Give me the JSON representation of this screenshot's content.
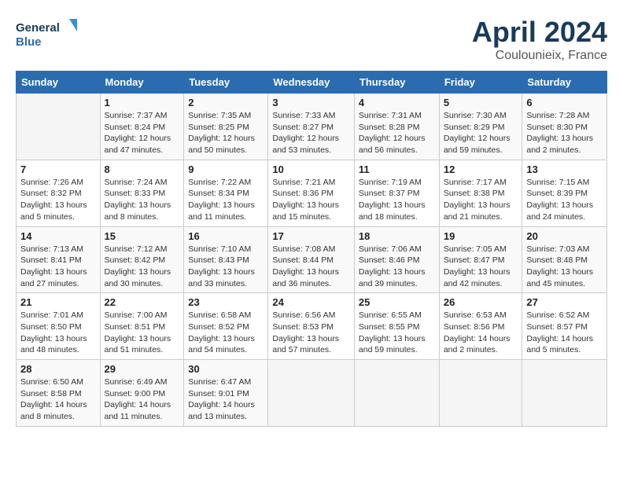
{
  "header": {
    "logo_line1": "General",
    "logo_line2": "Blue",
    "title": "April 2024",
    "subtitle": "Coulounieix, France"
  },
  "columns": [
    "Sunday",
    "Monday",
    "Tuesday",
    "Wednesday",
    "Thursday",
    "Friday",
    "Saturday"
  ],
  "weeks": [
    [
      {
        "day": "",
        "sunrise": "",
        "sunset": "",
        "daylight": ""
      },
      {
        "day": "1",
        "sunrise": "Sunrise: 7:37 AM",
        "sunset": "Sunset: 8:24 PM",
        "daylight": "Daylight: 12 hours and 47 minutes."
      },
      {
        "day": "2",
        "sunrise": "Sunrise: 7:35 AM",
        "sunset": "Sunset: 8:25 PM",
        "daylight": "Daylight: 12 hours and 50 minutes."
      },
      {
        "day": "3",
        "sunrise": "Sunrise: 7:33 AM",
        "sunset": "Sunset: 8:27 PM",
        "daylight": "Daylight: 12 hours and 53 minutes."
      },
      {
        "day": "4",
        "sunrise": "Sunrise: 7:31 AM",
        "sunset": "Sunset: 8:28 PM",
        "daylight": "Daylight: 12 hours and 56 minutes."
      },
      {
        "day": "5",
        "sunrise": "Sunrise: 7:30 AM",
        "sunset": "Sunset: 8:29 PM",
        "daylight": "Daylight: 12 hours and 59 minutes."
      },
      {
        "day": "6",
        "sunrise": "Sunrise: 7:28 AM",
        "sunset": "Sunset: 8:30 PM",
        "daylight": "Daylight: 13 hours and 2 minutes."
      }
    ],
    [
      {
        "day": "7",
        "sunrise": "Sunrise: 7:26 AM",
        "sunset": "Sunset: 8:32 PM",
        "daylight": "Daylight: 13 hours and 5 minutes."
      },
      {
        "day": "8",
        "sunrise": "Sunrise: 7:24 AM",
        "sunset": "Sunset: 8:33 PM",
        "daylight": "Daylight: 13 hours and 8 minutes."
      },
      {
        "day": "9",
        "sunrise": "Sunrise: 7:22 AM",
        "sunset": "Sunset: 8:34 PM",
        "daylight": "Daylight: 13 hours and 11 minutes."
      },
      {
        "day": "10",
        "sunrise": "Sunrise: 7:21 AM",
        "sunset": "Sunset: 8:36 PM",
        "daylight": "Daylight: 13 hours and 15 minutes."
      },
      {
        "day": "11",
        "sunrise": "Sunrise: 7:19 AM",
        "sunset": "Sunset: 8:37 PM",
        "daylight": "Daylight: 13 hours and 18 minutes."
      },
      {
        "day": "12",
        "sunrise": "Sunrise: 7:17 AM",
        "sunset": "Sunset: 8:38 PM",
        "daylight": "Daylight: 13 hours and 21 minutes."
      },
      {
        "day": "13",
        "sunrise": "Sunrise: 7:15 AM",
        "sunset": "Sunset: 8:39 PM",
        "daylight": "Daylight: 13 hours and 24 minutes."
      }
    ],
    [
      {
        "day": "14",
        "sunrise": "Sunrise: 7:13 AM",
        "sunset": "Sunset: 8:41 PM",
        "daylight": "Daylight: 13 hours and 27 minutes."
      },
      {
        "day": "15",
        "sunrise": "Sunrise: 7:12 AM",
        "sunset": "Sunset: 8:42 PM",
        "daylight": "Daylight: 13 hours and 30 minutes."
      },
      {
        "day": "16",
        "sunrise": "Sunrise: 7:10 AM",
        "sunset": "Sunset: 8:43 PM",
        "daylight": "Daylight: 13 hours and 33 minutes."
      },
      {
        "day": "17",
        "sunrise": "Sunrise: 7:08 AM",
        "sunset": "Sunset: 8:44 PM",
        "daylight": "Daylight: 13 hours and 36 minutes."
      },
      {
        "day": "18",
        "sunrise": "Sunrise: 7:06 AM",
        "sunset": "Sunset: 8:46 PM",
        "daylight": "Daylight: 13 hours and 39 minutes."
      },
      {
        "day": "19",
        "sunrise": "Sunrise: 7:05 AM",
        "sunset": "Sunset: 8:47 PM",
        "daylight": "Daylight: 13 hours and 42 minutes."
      },
      {
        "day": "20",
        "sunrise": "Sunrise: 7:03 AM",
        "sunset": "Sunset: 8:48 PM",
        "daylight": "Daylight: 13 hours and 45 minutes."
      }
    ],
    [
      {
        "day": "21",
        "sunrise": "Sunrise: 7:01 AM",
        "sunset": "Sunset: 8:50 PM",
        "daylight": "Daylight: 13 hours and 48 minutes."
      },
      {
        "day": "22",
        "sunrise": "Sunrise: 7:00 AM",
        "sunset": "Sunset: 8:51 PM",
        "daylight": "Daylight: 13 hours and 51 minutes."
      },
      {
        "day": "23",
        "sunrise": "Sunrise: 6:58 AM",
        "sunset": "Sunset: 8:52 PM",
        "daylight": "Daylight: 13 hours and 54 minutes."
      },
      {
        "day": "24",
        "sunrise": "Sunrise: 6:56 AM",
        "sunset": "Sunset: 8:53 PM",
        "daylight": "Daylight: 13 hours and 57 minutes."
      },
      {
        "day": "25",
        "sunrise": "Sunrise: 6:55 AM",
        "sunset": "Sunset: 8:55 PM",
        "daylight": "Daylight: 13 hours and 59 minutes."
      },
      {
        "day": "26",
        "sunrise": "Sunrise: 6:53 AM",
        "sunset": "Sunset: 8:56 PM",
        "daylight": "Daylight: 14 hours and 2 minutes."
      },
      {
        "day": "27",
        "sunrise": "Sunrise: 6:52 AM",
        "sunset": "Sunset: 8:57 PM",
        "daylight": "Daylight: 14 hours and 5 minutes."
      }
    ],
    [
      {
        "day": "28",
        "sunrise": "Sunrise: 6:50 AM",
        "sunset": "Sunset: 8:58 PM",
        "daylight": "Daylight: 14 hours and 8 minutes."
      },
      {
        "day": "29",
        "sunrise": "Sunrise: 6:49 AM",
        "sunset": "Sunset: 9:00 PM",
        "daylight": "Daylight: 14 hours and 11 minutes."
      },
      {
        "day": "30",
        "sunrise": "Sunrise: 6:47 AM",
        "sunset": "Sunset: 9:01 PM",
        "daylight": "Daylight: 14 hours and 13 minutes."
      },
      {
        "day": "",
        "sunrise": "",
        "sunset": "",
        "daylight": ""
      },
      {
        "day": "",
        "sunrise": "",
        "sunset": "",
        "daylight": ""
      },
      {
        "day": "",
        "sunrise": "",
        "sunset": "",
        "daylight": ""
      },
      {
        "day": "",
        "sunrise": "",
        "sunset": "",
        "daylight": ""
      }
    ]
  ]
}
